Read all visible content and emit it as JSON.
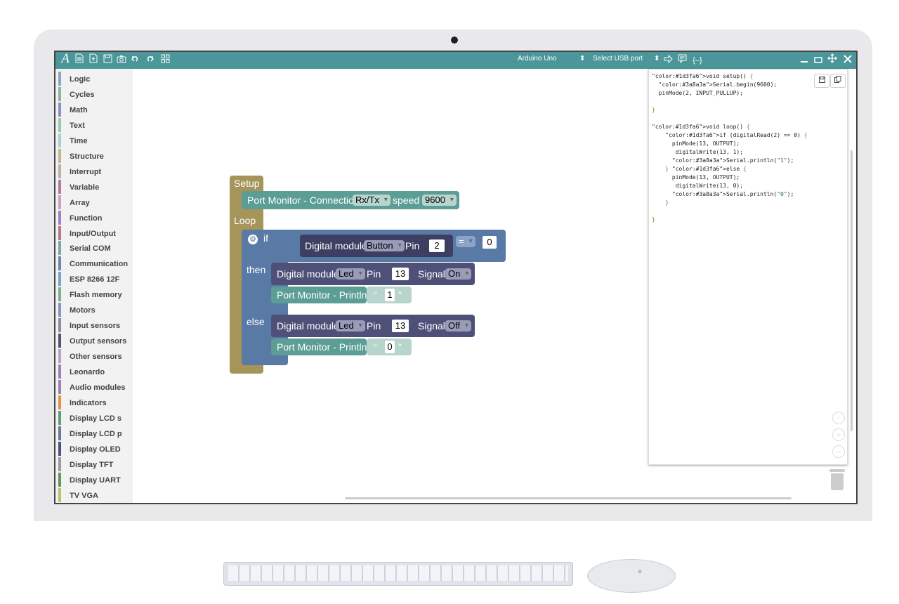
{
  "toolbar": {
    "icons": [
      "brand-logo-icon",
      "new-file-icon",
      "open-file-icon",
      "save-file-icon",
      "screenshot-icon",
      "undo-icon",
      "redo-icon",
      "blocks-grid-icon"
    ],
    "logo_glyph": "A",
    "board_select": "Arduino Uno",
    "port_select": "Select USB port",
    "right_icons": [
      "upload-arrow-icon",
      "serial-monitor-icon",
      "code-view-icon"
    ],
    "window_icons": [
      "minimize-icon",
      "maximize-icon",
      "move-icon",
      "close-icon"
    ]
  },
  "sidebar": {
    "categories": [
      {
        "label": "Logic",
        "color": "#8aa5c7"
      },
      {
        "label": "Cycles",
        "color": "#8fb59a"
      },
      {
        "label": "Math",
        "color": "#8e8fc8"
      },
      {
        "label": "Text",
        "color": "#9ec7b0"
      },
      {
        "label": "Time",
        "color": "#a9cfd6"
      },
      {
        "label": "Structure",
        "color": "#c2b98a"
      },
      {
        "label": "Interrupt",
        "color": "#b9b2a6"
      },
      {
        "label": "Variable",
        "color": "#b37ba1"
      },
      {
        "label": "Array",
        "color": "#c9a2c5"
      },
      {
        "label": "Function",
        "color": "#a47fc7"
      },
      {
        "label": "Input/Output",
        "color": "#b9788a"
      },
      {
        "label": "Serial COM",
        "color": "#7fa6a2"
      },
      {
        "label": "Communication",
        "color": "#6f86b3"
      },
      {
        "label": "ESP 8266 12F",
        "color": "#7aa3c9"
      },
      {
        "label": "Flash memory",
        "color": "#7bb08b"
      },
      {
        "label": "Motors",
        "color": "#8b90c8"
      },
      {
        "label": "Input sensors",
        "color": "#8c8da3"
      },
      {
        "label": "Output sensors",
        "color": "#4c5576"
      },
      {
        "label": "Other sensors",
        "color": "#b5a3c9"
      },
      {
        "label": "Leonardo",
        "color": "#a07fb8"
      },
      {
        "label": "Audio modules",
        "color": "#9a85b2"
      },
      {
        "label": "Indicators",
        "color": "#e0944a"
      },
      {
        "label": "Display LCD s",
        "color": "#5ea07a"
      },
      {
        "label": "Display LCD p",
        "color": "#6a7a99"
      },
      {
        "label": "Display OLED",
        "color": "#4f5080"
      },
      {
        "label": "Display TFT",
        "color": "#9a9aa8"
      },
      {
        "label": "Display UART",
        "color": "#5c9a58"
      },
      {
        "label": "TV VGA",
        "color": "#b8c26a"
      }
    ]
  },
  "blocks": {
    "setup_label": "Setup",
    "loop_label": "Loop",
    "port_connection_label": "Port Monitor - Connection",
    "port_connection_mode": "Rx/Tx",
    "speed_label": "speed",
    "speed_value": "9600",
    "if_label": "if",
    "then_label": "then",
    "else_label": "else",
    "digital_module_label": "Digital module",
    "button_type": "Button",
    "pin_label": "Pin",
    "button_pin": "2",
    "compare_op": "=",
    "compare_value": "0",
    "led_type": "Led",
    "led_pin": "13",
    "signal_label": "Signal",
    "signal_on": "On",
    "signal_off": "Off",
    "println_label": "Port Monitor - Println",
    "quote_open": "“",
    "quote_close": "”",
    "println_then_value": "1",
    "println_else_value": "0",
    "colors": {
      "setup_loop": "#a5955a",
      "serial": "#5c9e95",
      "serial_light": "#b8d5cd",
      "if_block": "#5a7aa6",
      "digital": "#4e5078",
      "digital_dark": "#3d3f62"
    }
  },
  "code_panel": {
    "lines": [
      "void setup() {",
      "  Serial.begin(9600);",
      "  pinMode(2, INPUT_PULLUP);",
      "",
      "}",
      "",
      "void loop() {",
      "    if (digitalRead(2) == 0) {",
      "      pinMode(13, OUTPUT);",
      "       digitalWrite(13, 1);",
      "      Serial.println(\"1\");",
      "    } else {",
      "      pinMode(13, OUTPUT);",
      "       digitalWrite(13, 0);",
      "      Serial.println(\"0\");",
      "    }",
      "",
      "}"
    ],
    "buttons": [
      "save-code-icon",
      "copy-code-icon"
    ]
  }
}
